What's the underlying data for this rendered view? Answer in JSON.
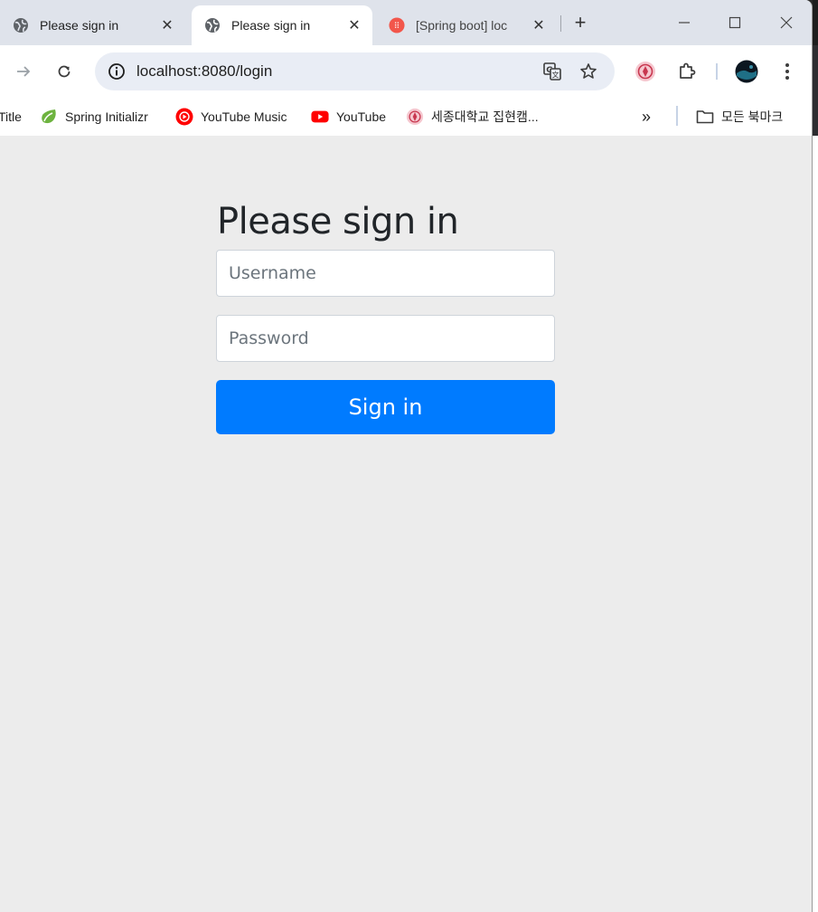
{
  "tabs": [
    {
      "title": "Please sign in",
      "icon": "globe-icon",
      "active": false
    },
    {
      "title": "Please sign in",
      "icon": "globe-icon",
      "active": true
    },
    {
      "title": "[Spring boot] loc",
      "icon": "velog-icon",
      "active": false
    }
  ],
  "window_controls": {
    "minimize": "minimize-icon",
    "maximize": "maximize-icon",
    "close": "close-icon"
  },
  "toolbar": {
    "url": "localhost:8080/login"
  },
  "bookmarks": {
    "items": [
      {
        "label": "Title"
      },
      {
        "label": "Spring Initializr",
        "icon": "spring-icon"
      },
      {
        "label": "YouTube Music",
        "icon": "youtube-music-icon"
      },
      {
        "label": "YouTube",
        "icon": "youtube-icon"
      },
      {
        "label": "세종대학교 집현캠..."
      }
    ],
    "all_bookmarks": "모든 북마크"
  },
  "login": {
    "heading": "Please sign in",
    "username_placeholder": "Username",
    "password_placeholder": "Password",
    "submit_label": "Sign in"
  },
  "colors": {
    "accent": "#007bff",
    "page_bg": "#ececec",
    "tabstrip_bg": "#dfe3eb"
  }
}
